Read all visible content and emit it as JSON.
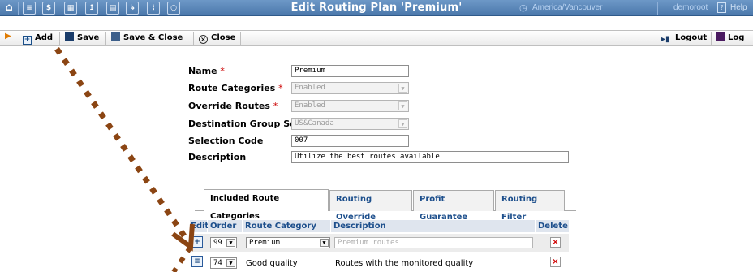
{
  "app": {
    "title": "Edit Routing Plan 'Premium'",
    "timezone": "America/Vancouver",
    "user": "demoroot",
    "help": "Help"
  },
  "nav_icons": [
    "home-icon",
    "list-icon",
    "dollar-icon",
    "accounts-icon",
    "upload-icon",
    "customers-icon",
    "route-icon",
    "chart-icon",
    "search-icon"
  ],
  "toolbar": {
    "add": "Add",
    "save": "Save",
    "save_close": "Save & Close",
    "close": "Close",
    "logout": "Logout",
    "log": "Log"
  },
  "form": {
    "name_label": "Name",
    "name_value": "Premium",
    "route_categories_label": "Route Categories",
    "route_categories_value": "Enabled",
    "override_routes_label": "Override Routes",
    "override_routes_value": "Enabled",
    "dest_group_set_label": "Destination Group Set",
    "dest_group_set_value": "US&Canada",
    "selection_code_label": "Selection Code",
    "selection_code_value": "007",
    "description_label": "Description",
    "description_value": "Utilize the best routes available",
    "required_mark": "*"
  },
  "tabs": [
    {
      "label": "Included Route Categories",
      "active": true
    },
    {
      "label": "Routing Override",
      "active": false
    },
    {
      "label": "Profit Guarantee",
      "active": false
    },
    {
      "label": "Routing Filter",
      "active": false
    }
  ],
  "table": {
    "headers": [
      "Edit",
      "Order",
      "Route Category",
      "Description",
      "Delete"
    ],
    "new_row": {
      "order": "99",
      "category": "Premium",
      "description_placeholder": "Premium routes"
    },
    "rows": [
      {
        "order": "74",
        "category": "Good quality",
        "description": "Routes with the monitored quality"
      }
    ]
  },
  "colors": {
    "topbar": "#5a87b9",
    "link": "#1d4f8c",
    "annotation_arrow": "#8b4513",
    "required": "#cc0000",
    "delete_x": "#d00000"
  }
}
